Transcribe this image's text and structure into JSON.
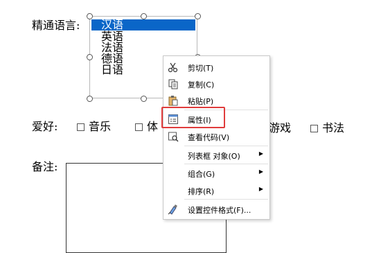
{
  "form": {
    "language_label": "精通语言:",
    "hobby_label": "爱好:",
    "notes_label": "备注:",
    "languages": [
      "汉语",
      "英语",
      "法语",
      "德语",
      "日语"
    ],
    "selected_language": "汉语",
    "hobbies": [
      {
        "label": "音乐",
        "checked": false
      },
      {
        "label": "体",
        "checked": false
      },
      {
        "label": "游戏",
        "checked": false
      },
      {
        "label": "书法",
        "checked": false
      }
    ]
  },
  "context_menu": {
    "items": [
      {
        "label": "剪切(T)",
        "icon": "scissors-icon"
      },
      {
        "label": "复制(C)",
        "icon": "copy-icon"
      },
      {
        "label": "粘贴(P)",
        "icon": "paste-icon"
      },
      {
        "label": "属性(I)",
        "icon": "properties-icon"
      },
      {
        "label": "查看代码(V)",
        "icon": "view-code-icon"
      },
      {
        "label": "列表框 对象(O)",
        "submenu": true
      },
      {
        "label": "组合(G)",
        "submenu": true
      },
      {
        "label": "排序(R)",
        "submenu": true
      },
      {
        "label": "设置控件格式(F)...",
        "icon": "format-control-icon"
      }
    ],
    "highlighted_item": "属性(I)"
  },
  "colors": {
    "selection": "#0a66c8",
    "highlight_border": "#e03c3c"
  }
}
